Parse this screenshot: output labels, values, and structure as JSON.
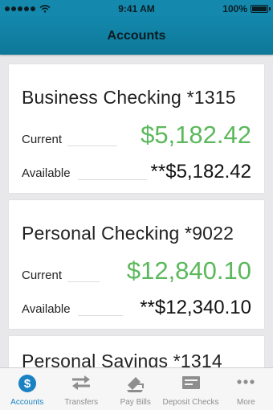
{
  "status_bar": {
    "time": "9:41 AM",
    "battery": "100%",
    "signal_icon": "signal-dots-icon",
    "wifi_icon": "wifi-icon"
  },
  "nav": {
    "title": "Accounts"
  },
  "accounts": [
    {
      "name": "Business Checking *1315",
      "current_label": "Current",
      "current_value": "$5,182.42",
      "available_label": "Available",
      "available_value": "**$5,182.42"
    },
    {
      "name": "Personal Checking *9022",
      "current_label": "Current",
      "current_value": "$12,840.10",
      "available_label": "Available",
      "available_value": "**$12,340.10"
    },
    {
      "name": "Personal Savings *1314"
    }
  ],
  "tabs": [
    {
      "label": "Accounts",
      "icon": "dollar-circle-icon",
      "active": true
    },
    {
      "label": "Transfers",
      "icon": "transfer-arrows-icon",
      "active": false
    },
    {
      "label": "Pay Bills",
      "icon": "pay-bills-icon",
      "active": false
    },
    {
      "label": "Deposit Checks",
      "icon": "deposit-check-icon",
      "active": false
    },
    {
      "label": "More",
      "icon": "more-dots-icon",
      "active": false
    }
  ],
  "colors": {
    "header": "#1489ad",
    "balance_green": "#5cb85c",
    "tab_active": "#1a82c3",
    "tab_inactive": "#8e8e8e"
  }
}
